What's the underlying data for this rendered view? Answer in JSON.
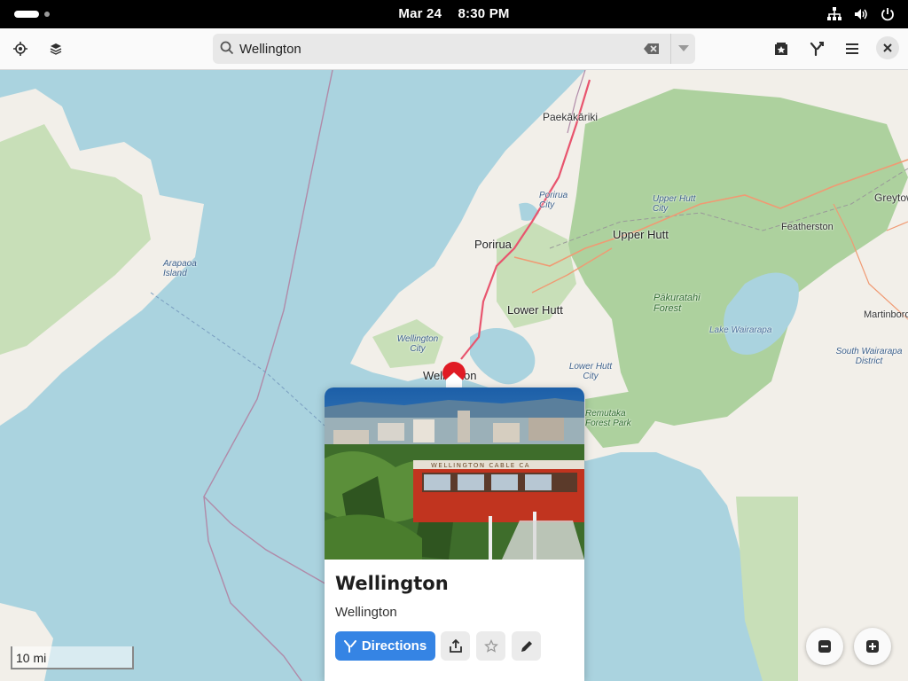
{
  "topbar": {
    "date": "Mar 24",
    "time": "8:30 PM",
    "icons": [
      "network-icon",
      "volume-icon",
      "power-icon"
    ]
  },
  "header": {
    "locate_icon": "crosshair-icon",
    "layers_icon": "layers-icon",
    "search": {
      "value": "Wellington",
      "placeholder": "Search"
    },
    "favorites_icon": "star-box-icon",
    "route_icon": "route-icon",
    "menu_icon": "hamburger-icon",
    "close_icon": "close-icon"
  },
  "map": {
    "colors": {
      "water": "#aad3df",
      "land": "#f2efe9",
      "forest": "#add19e",
      "road": "#e8556e"
    },
    "labels": {
      "paekakariki": "Paekākāriki",
      "porirua_city": "Porirua City",
      "upper_hutt_city": "Upper Hutt City",
      "greytown": "Greytow",
      "porirua": "Porirua",
      "upper_hutt": "Upper Hutt",
      "featherston": "Featherston",
      "arapaoa": "Arapaoa Island",
      "pakuratahi": "Pākuratahi Forest",
      "martinborough": "Martinborou",
      "lower_hutt": "Lower Hutt",
      "lake_wairarapa": "Lake Wairarapa",
      "south_wairarapa": "South Wairarapa District",
      "wellington_city": "Wellington City",
      "lower_hutt_city": "Lower Hutt City",
      "wellington": "Wellington",
      "remutaka": "Remutaka Forest Park"
    },
    "scale_label": "10 mi"
  },
  "place_card": {
    "title": "Wellington",
    "subtitle": "Wellington",
    "photo_caption": "WELLINGTON CABLE CA",
    "directions_label": "Directions",
    "actions": [
      "share-icon",
      "star-icon",
      "edit-icon"
    ]
  },
  "zoom": {
    "out_icon": "minus-icon",
    "in_icon": "plus-icon"
  }
}
